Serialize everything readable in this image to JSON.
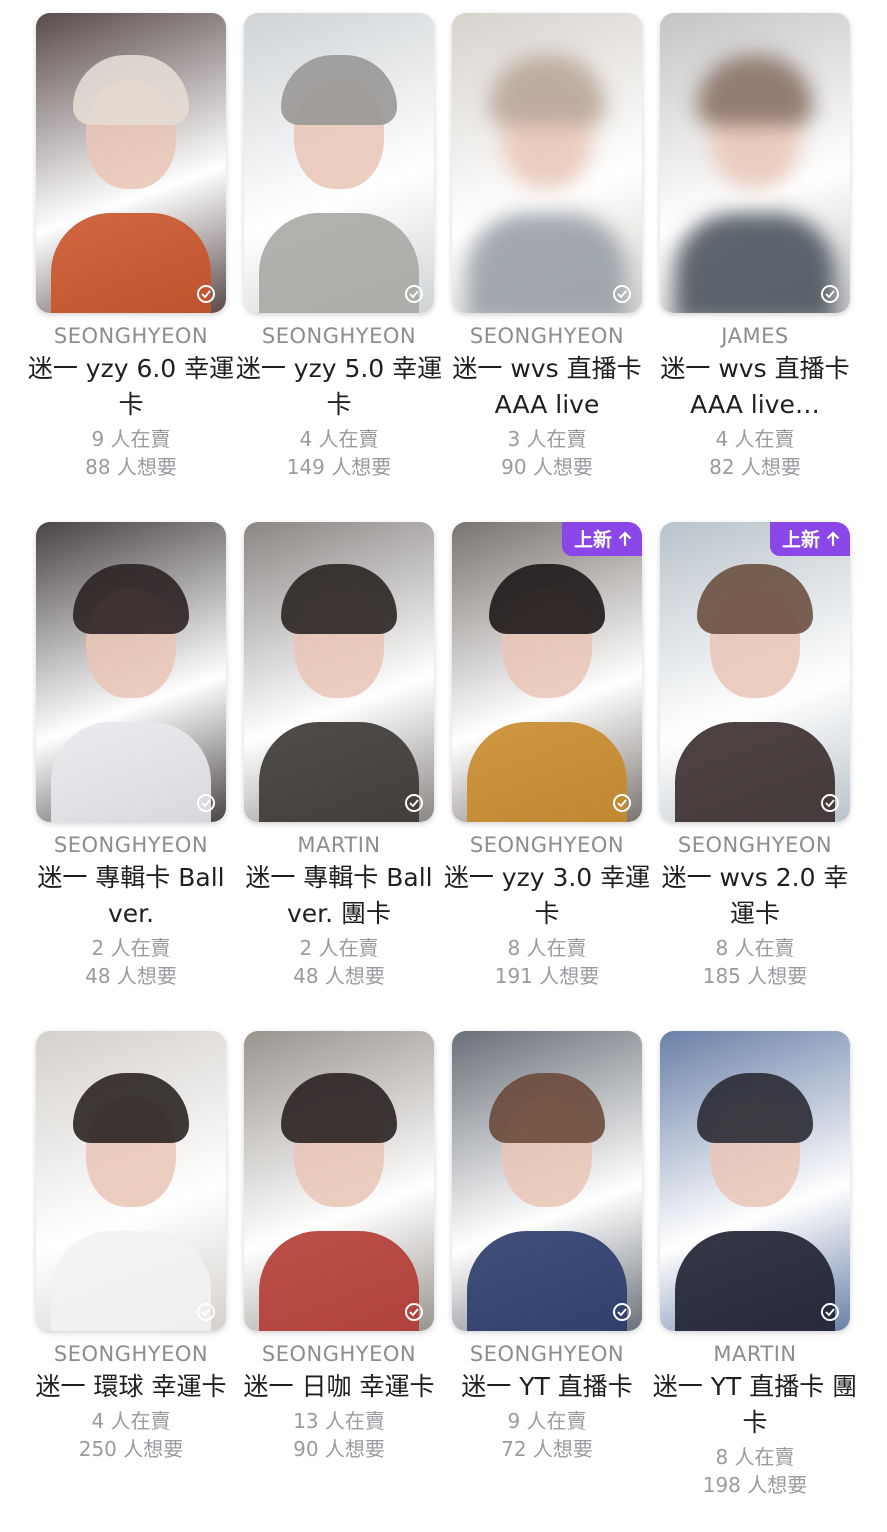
{
  "accent_color": "#8a46e6",
  "cards": [
    {
      "artist": "SEONGHYEON",
      "title": "迷一 yzy 6.0 幸運卡",
      "selling": "9 人在賣",
      "wanting": "88 人想要",
      "badge": "",
      "colors": [
        "#5a4a4a",
        "#e4dcd4",
        "#c9542a"
      ],
      "blur": false
    },
    {
      "artist": "SEONGHYEON",
      "title": "迷一 yzy 5.0 幸運卡",
      "selling": "4 人在賣",
      "wanting": "149 人想要",
      "badge": "",
      "colors": [
        "#cfd3d6",
        "#9a9896",
        "#a9a7a4"
      ],
      "blur": false
    },
    {
      "artist": "SEONGHYEON",
      "title": "迷一 wvs 直播卡 AAA live",
      "selling": "3 人在賣",
      "wanting": "90 人想要",
      "badge": "",
      "colors": [
        "#d7d2cc",
        "#b9a89a",
        "#9aa0a8"
      ],
      "blur": true
    },
    {
      "artist": "JAMES",
      "title": "迷一 wvs 直播卡 AAA live…",
      "selling": "4 人在賣",
      "wanting": "82 人想要",
      "badge": "",
      "colors": [
        "#c4c4c4",
        "#8a7468",
        "#4e5660"
      ],
      "blur": true
    },
    {
      "artist": "SEONGHYEON",
      "title": "迷一 專輯卡 Ball ver.",
      "selling": "2 人在賣",
      "wanting": "48 人想要",
      "badge": "",
      "colors": [
        "#4a4444",
        "#2c2424",
        "#e8e8ec"
      ],
      "blur": false
    },
    {
      "artist": "MARTIN",
      "title": "迷一 專輯卡 Ball ver. 團卡",
      "selling": "2 人在賣",
      "wanting": "48 人想要",
      "badge": "",
      "colors": [
        "#8a8684",
        "#2a2624",
        "#3a3634"
      ],
      "blur": false
    },
    {
      "artist": "SEONGHYEON",
      "title": "迷一 yzy 3.0 幸運卡",
      "selling": "8 人在賣",
      "wanting": "191 人想要",
      "badge": "上新",
      "colors": [
        "#7a7470",
        "#1e1a1a",
        "#c88a2a"
      ],
      "blur": false
    },
    {
      "artist": "SEONGHYEON",
      "title": "迷一 wvs 2.0 幸運卡",
      "selling": "8 人在賣",
      "wanting": "185 人想要",
      "badge": "上新",
      "colors": [
        "#b9c3ca",
        "#6a5040",
        "#3a2c2c"
      ],
      "blur": false
    },
    {
      "artist": "SEONGHYEON",
      "title": "迷一 環球 幸運卡",
      "selling": "4 人在賣",
      "wanting": "250 人想要",
      "badge": "",
      "colors": [
        "#d4d0cc",
        "#2a2422",
        "#f2f2f2"
      ],
      "blur": false
    },
    {
      "artist": "SEONGHYEON",
      "title": "迷一 日咖 幸運卡",
      "selling": "13 人在賣",
      "wanting": "90 人想要",
      "badge": "",
      "colors": [
        "#9a948e",
        "#2a2222",
        "#b23a32"
      ],
      "blur": false
    },
    {
      "artist": "SEONGHYEON",
      "title": "迷一 YT 直播卡",
      "selling": "9 人在賣",
      "wanting": "72 人想要",
      "badge": "",
      "colors": [
        "#6a7078",
        "#6a4a3a",
        "#2a3a6a"
      ],
      "blur": false
    },
    {
      "artist": "MARTIN",
      "title": "迷一 YT 直播卡 團卡",
      "selling": "8 人在賣",
      "wanting": "198 人想要",
      "badge": "",
      "colors": [
        "#6a80a8",
        "#2a2a34",
        "#1e2030"
      ],
      "blur": false
    }
  ]
}
